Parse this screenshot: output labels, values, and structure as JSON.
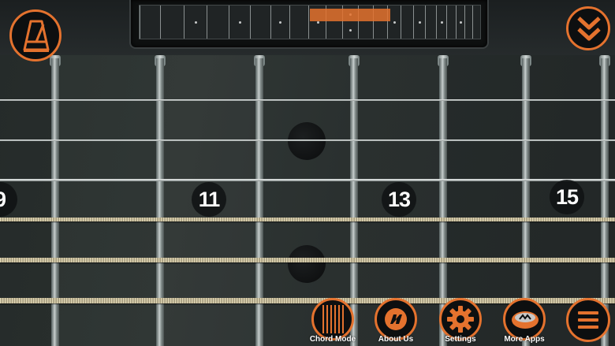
{
  "fret_markers": [
    {
      "label": "9"
    },
    {
      "label": "11"
    },
    {
      "label": "13"
    },
    {
      "label": "15"
    }
  ],
  "top_controls": {
    "metronome_icon": "metronome-icon",
    "collapse_icon": "double-chevron-down-icon"
  },
  "toolbar": {
    "chord_mode_label": "Chord Mode",
    "about_us_label": "About Us",
    "settings_label": "Settings",
    "more_apps_label": "More Apps",
    "menu_icon": "hamburger-menu-icon"
  },
  "colors": {
    "accent": "#e4722e",
    "board": "#2d3432"
  }
}
